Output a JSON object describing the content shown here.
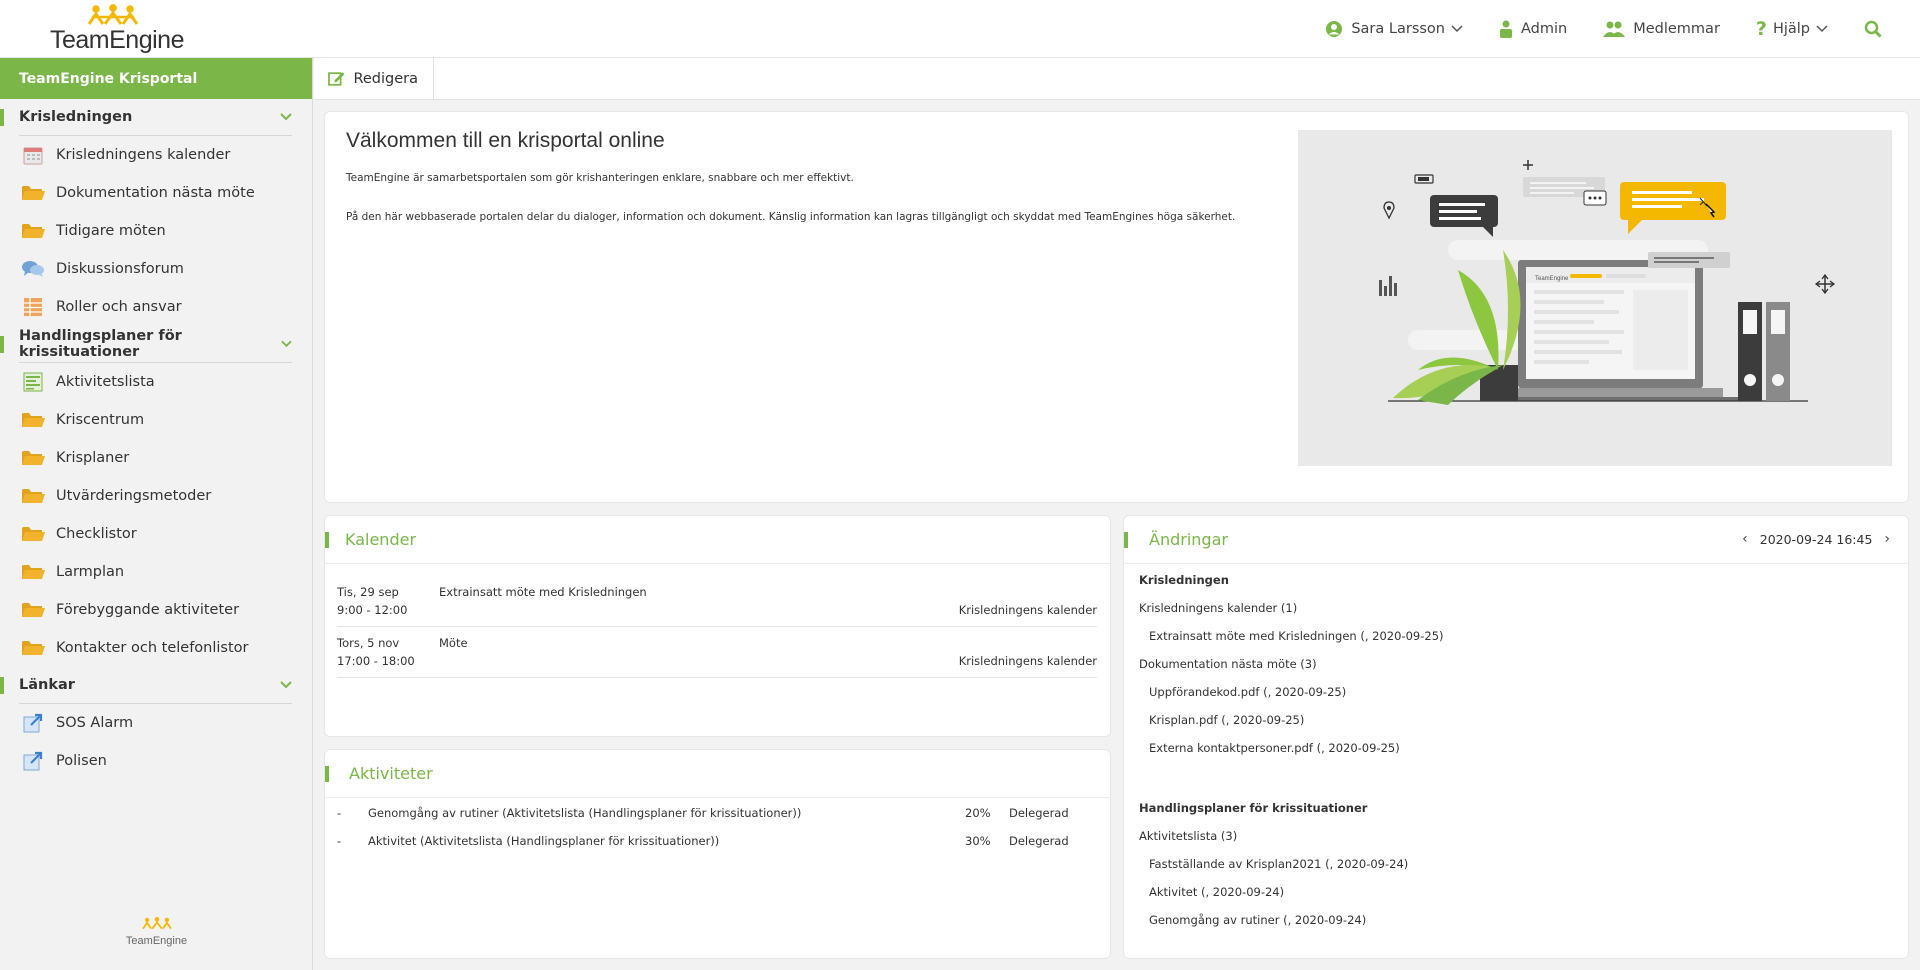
{
  "header": {
    "logo_text": "TeamEngine",
    "user_name": "Sara Larsson",
    "admin_label": "Admin",
    "members_label": "Medlemmar",
    "help_label": "Hjälp"
  },
  "colors": {
    "accent": "#7ab648",
    "logo_yellow": "#f5b800",
    "folder": "#f2b32c"
  },
  "sidebar": {
    "portal_title": "TeamEngine Krisportal",
    "sections": [
      {
        "title": "Krisledningen",
        "items": [
          {
            "label": "Krisledningens kalender",
            "icon": "calendar-icon"
          },
          {
            "label": "Dokumentation nästa möte",
            "icon": "folder-icon"
          },
          {
            "label": "Tidigare möten",
            "icon": "folder-icon"
          },
          {
            "label": "Diskussionsforum",
            "icon": "chat-bubbles-icon"
          },
          {
            "label": "Roller och ansvar",
            "icon": "table-icon"
          }
        ]
      },
      {
        "title": "Handlingsplaner för krissituationer",
        "items": [
          {
            "label": "Aktivitetslista",
            "icon": "list-icon"
          },
          {
            "label": "Kriscentrum",
            "icon": "folder-icon"
          },
          {
            "label": "Krisplaner",
            "icon": "folder-icon"
          },
          {
            "label": "Utvärderingsmetoder",
            "icon": "folder-icon"
          },
          {
            "label": "Checklistor",
            "icon": "folder-icon"
          },
          {
            "label": "Larmplan",
            "icon": "folder-icon"
          },
          {
            "label": "Förebyggande aktiviteter",
            "icon": "folder-icon"
          },
          {
            "label": "Kontakter och telefonlistor",
            "icon": "folder-icon"
          }
        ]
      },
      {
        "title": "Länkar",
        "items": [
          {
            "label": "SOS Alarm",
            "icon": "external-link-icon"
          },
          {
            "label": "Polisen",
            "icon": "external-link-icon"
          }
        ]
      }
    ],
    "footer_logo_text": "TeamEngine"
  },
  "toolbar": {
    "edit_label": "Redigera"
  },
  "welcome": {
    "title": "Välkommen till en krisportal online",
    "paragraph1": "TeamEngine är samarbetsportalen som gör krishanteringen enklare, snabbare och mer effektivt.",
    "paragraph2": "På den här webbaserade portalen delar du dialoger, information och dokument. Känslig information kan lagras tillgängligt och skyddat med TeamEngines höga säkerhet.",
    "illustration_logo": "TeamEngine"
  },
  "calendar": {
    "title": "Kalender",
    "events": [
      {
        "date": "Tis, 29 sep",
        "time": "9:00 - 12:00",
        "title": "Extrainsatt möte med Krisledningen",
        "source": "Krisledningens kalender"
      },
      {
        "date": "Tors, 5 nov",
        "time": "17:00 - 18:00",
        "title": "Möte",
        "source": "Krisledningens kalender"
      }
    ]
  },
  "activities": {
    "title": "Aktiviteter",
    "rows": [
      {
        "dash": "-",
        "name": "Genomgång av rutiner (Aktivitetslista (Handlingsplaner för krissituationer))",
        "percent": "20%",
        "status": "Delegerad"
      },
      {
        "dash": "-",
        "name": "Aktivitet (Aktivitetslista (Handlingsplaner för krissituationer))",
        "percent": "30%",
        "status": "Delegerad"
      }
    ]
  },
  "changes": {
    "title": "Ändringar",
    "datetime": "2020-09-24 16:45",
    "lines": [
      {
        "text": "Krisledningen",
        "kind": "group"
      },
      {
        "text": "Krisledningens kalender (1)",
        "kind": "sub"
      },
      {
        "text": "Extrainsatt möte med Krisledningen (, 2020-09-25)",
        "kind": "entry"
      },
      {
        "text": "Dokumentation nästa möte (3)",
        "kind": "sub"
      },
      {
        "text": "Uppförandekod.pdf (, 2020-09-25)",
        "kind": "entry"
      },
      {
        "text": "Krisplan.pdf (, 2020-09-25)",
        "kind": "entry"
      },
      {
        "text": "Externa kontaktpersoner.pdf (, 2020-09-25)",
        "kind": "entry"
      },
      {
        "text": "Handlingsplaner för krissituationer",
        "kind": "group"
      },
      {
        "text": "Aktivitetslista (3)",
        "kind": "sub"
      },
      {
        "text": "Fastställande av Krisplan2021 (, 2020-09-24)",
        "kind": "entry"
      },
      {
        "text": "Aktivitet (, 2020-09-24)",
        "kind": "entry"
      },
      {
        "text": "Genomgång av rutiner (, 2020-09-24)",
        "kind": "entry"
      }
    ]
  }
}
